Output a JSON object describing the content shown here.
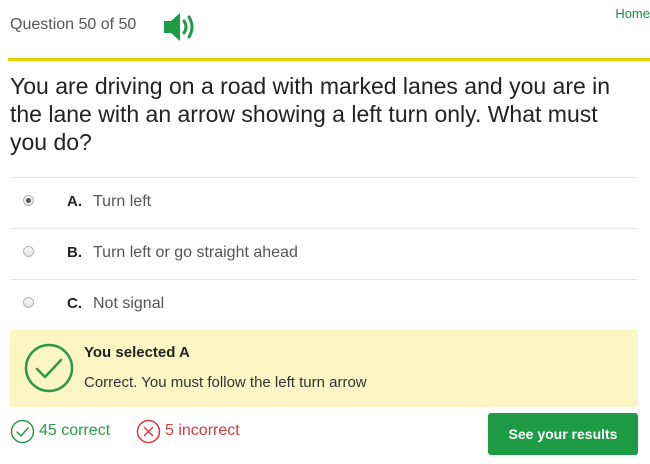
{
  "header": {
    "progress": "Question 50 of 50",
    "speaker_icon": "speaker-icon",
    "home_link": "Home"
  },
  "question": {
    "text": "You are driving on a road with marked lanes and you are in the lane with an arrow showing a left turn only. What must you do?"
  },
  "options": [
    {
      "letter": "A.",
      "text": "Turn left",
      "selected": true
    },
    {
      "letter": "B.",
      "text": "Turn left or go straight ahead",
      "selected": false
    },
    {
      "letter": "C.",
      "text": "Not signal",
      "selected": false
    }
  ],
  "feedback": {
    "title": "You selected A",
    "text": "Correct. You must follow the left turn arrow",
    "icon": "check-circle-icon"
  },
  "stats": {
    "correct": "45 correct",
    "incorrect": "5 incorrect"
  },
  "results_button": "See your results",
  "colors": {
    "accent_green": "#1f9b46",
    "rule_yellow": "#e7d200",
    "feedback_bg": "#fdf5c4",
    "incorrect_red": "#d23b3b"
  }
}
